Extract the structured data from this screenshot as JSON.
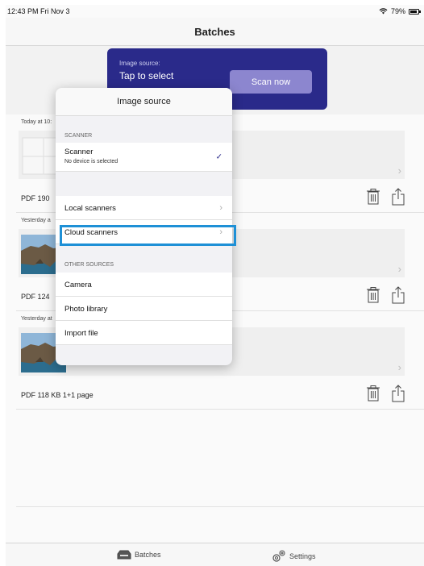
{
  "status": {
    "time": "12:43 PM  Fri Nov 3",
    "battery": "79%"
  },
  "nav": {
    "title": "Batches"
  },
  "hero": {
    "source_label": "Image source:",
    "source_value": "Tap to select",
    "scan_button": "Scan now"
  },
  "batches": [
    {
      "date": "Today at 10:",
      "info": "PDF  190",
      "has_image": false
    },
    {
      "date": "Yesterday a",
      "info": "PDF  124 ",
      "has_image": true
    },
    {
      "date": "Yesterday at",
      "info": "PDF  118 KB  1+1 page",
      "has_image": true
    }
  ],
  "popover": {
    "title": "Image source",
    "scanner_header": "SCANNER",
    "scanner_label": "Scanner",
    "scanner_sub": "No device is selected",
    "local_scanners": "Local scanners",
    "cloud_scanners": "Cloud scanners",
    "other_header": "OTHER SOURCES",
    "camera": "Camera",
    "photo_library": "Photo library",
    "import_file": "Import file"
  },
  "tabs": {
    "batches": "Batches",
    "settings": "Settings"
  },
  "colors": {
    "accent": "#2a2a8a",
    "scan_button": "#8c86cf",
    "highlight": "#1e90d6"
  }
}
